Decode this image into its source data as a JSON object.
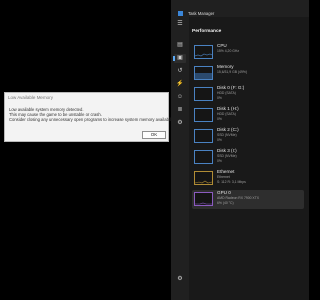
{
  "dialog": {
    "title": "Low Available Memory",
    "lines": [
      "Low available system memory detected.",
      "This may cause the game to be unstable or crash.",
      "Consider closing any unnecessary open programs to increase system memory availability."
    ],
    "ok_label": "OK"
  },
  "task_manager": {
    "title": "Task Manager",
    "section_title": "Performance",
    "resources": [
      {
        "name": "CPU",
        "line1": "15% 4,20 GHz",
        "line2": "",
        "kind": "cpu",
        "selected": false
      },
      {
        "name": "Memory",
        "line1": "15,6/31,9 GB (49%)",
        "line2": "",
        "kind": "memory",
        "selected": false
      },
      {
        "name": "Disk 0 (F: G:)",
        "line1": "HDD (SATA)",
        "line2": "0%",
        "kind": "disk",
        "selected": false
      },
      {
        "name": "Disk 1 (H:)",
        "line1": "HDD (SATA)",
        "line2": "0%",
        "kind": "disk",
        "selected": false
      },
      {
        "name": "Disk 2 (C:)",
        "line1": "SSD (NVMe)",
        "line2": "0%",
        "kind": "disk",
        "selected": false
      },
      {
        "name": "Disk 3 (I:)",
        "line1": "SSD (NVMe)",
        "line2": "0%",
        "kind": "disk",
        "selected": false
      },
      {
        "name": "Ethernet",
        "line1": "Ethernet",
        "line2": "S: 112 R: 3,1 Mbps",
        "kind": "ethernet",
        "selected": false
      },
      {
        "name": "GPU 0",
        "line1": "AMD Radeon RX 7900 XTX",
        "line2": "6% (40 °C)",
        "kind": "gpu",
        "selected": true
      }
    ]
  },
  "icons": {
    "app": "task-manager-app-icon",
    "nav": [
      "hamburger-icon",
      "processes-icon",
      "performance-icon",
      "app-history-icon",
      "startup-apps-icon",
      "users-icon",
      "details-icon",
      "services-icon",
      "settings-icon"
    ]
  },
  "colors": {
    "dialog_bg": "#f3f3f3",
    "window_bg": "#202020",
    "accent_blue": "#5ba9f5",
    "gpu_purple": "#8b5bc0",
    "ethernet_gold": "#b08c35"
  }
}
